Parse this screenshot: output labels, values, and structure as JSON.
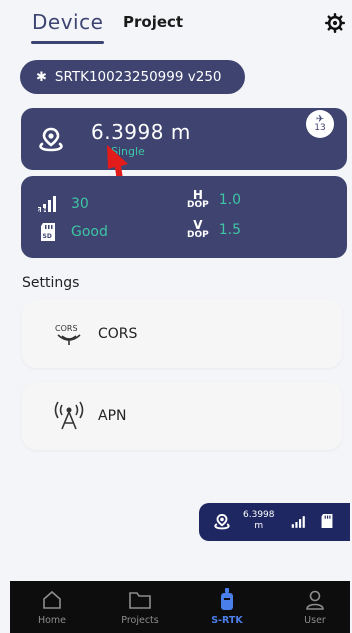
{
  "header": {
    "tabs": [
      {
        "label": "Device",
        "active": true
      },
      {
        "label": "Project",
        "active": false
      }
    ],
    "settings_icon": "gear-icon"
  },
  "device": {
    "name": "SRTK10023250999 v250",
    "icon": "bluetooth-icon"
  },
  "position": {
    "accuracy": "6.3998 m",
    "fix_status": "Single",
    "satellites": "13",
    "icon": "location-pin-icon",
    "status_color": "#3ec6a4"
  },
  "stats": {
    "signal": "30",
    "sd_status": "Good",
    "hdop_label_top": "H",
    "hdop_label_bottom": "DOP",
    "hdop": "1.0",
    "vdop_label_top": "V",
    "vdop_label_bottom": "DOP",
    "vdop": "1.5"
  },
  "settings": {
    "title": "Settings",
    "items": [
      {
        "label": "CORS",
        "icon": "cors-icon",
        "icon_text": "CORS"
      },
      {
        "label": "APN",
        "icon": "antenna-icon"
      }
    ]
  },
  "mini_status": {
    "value_line1": "6.3998",
    "value_line2": "m"
  },
  "bottom_nav": [
    {
      "label": "Home",
      "icon": "home-icon",
      "active": false
    },
    {
      "label": "Projects",
      "icon": "folder-icon",
      "active": false
    },
    {
      "label": "S-RTK",
      "icon": "rtk-receiver-icon",
      "active": true
    },
    {
      "label": "User",
      "icon": "user-icon",
      "active": false
    }
  ],
  "colors": {
    "card": "#3e4370",
    "accent_green": "#3ec6a4",
    "nav_active": "#4a7ee8",
    "annotation_arrow": "#e21b1b"
  }
}
